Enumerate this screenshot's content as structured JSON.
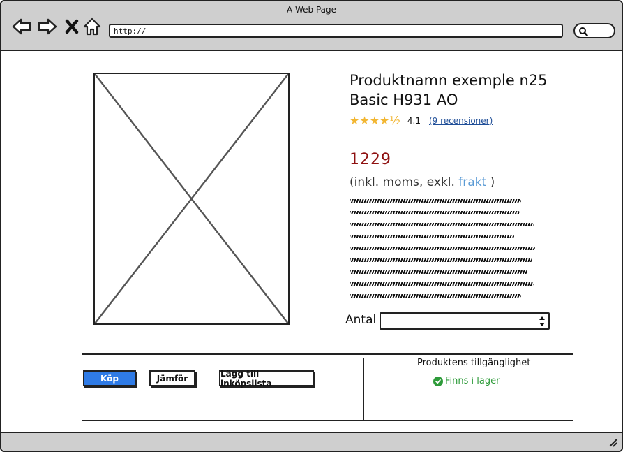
{
  "window": {
    "title": "A Web Page"
  },
  "toolbar": {
    "address_value": "http://",
    "icons": [
      "back-arrow-icon",
      "forward-arrow-icon",
      "close-x-icon",
      "home-icon",
      "search-icon"
    ]
  },
  "product": {
    "title_line1": "Produktnamn exemple n25",
    "title_line2": "Basic H931 AO",
    "rating": "4.1",
    "stars": "★★★★½",
    "reviews_link": "(9 recensioner)",
    "price": "1229",
    "price_note_prefix": "(inkl. moms, exkl.",
    "price_note_link": "frakt",
    "price_note_suffix": ")",
    "quantity_label": "Antal",
    "quantity_value": ""
  },
  "actions": {
    "buy": "Köp",
    "compare": "Jämför",
    "add_to_list": "Lägg till inköpslista"
  },
  "availability": {
    "title": "Produktens tillgänglighet",
    "status": "Finns i lager"
  },
  "colors": {
    "buy_button": "#2f7be6",
    "price": "#8e1010",
    "stock_ok": "#2e9b3a",
    "link": "#1f4e98",
    "stars": "#f2b632"
  }
}
